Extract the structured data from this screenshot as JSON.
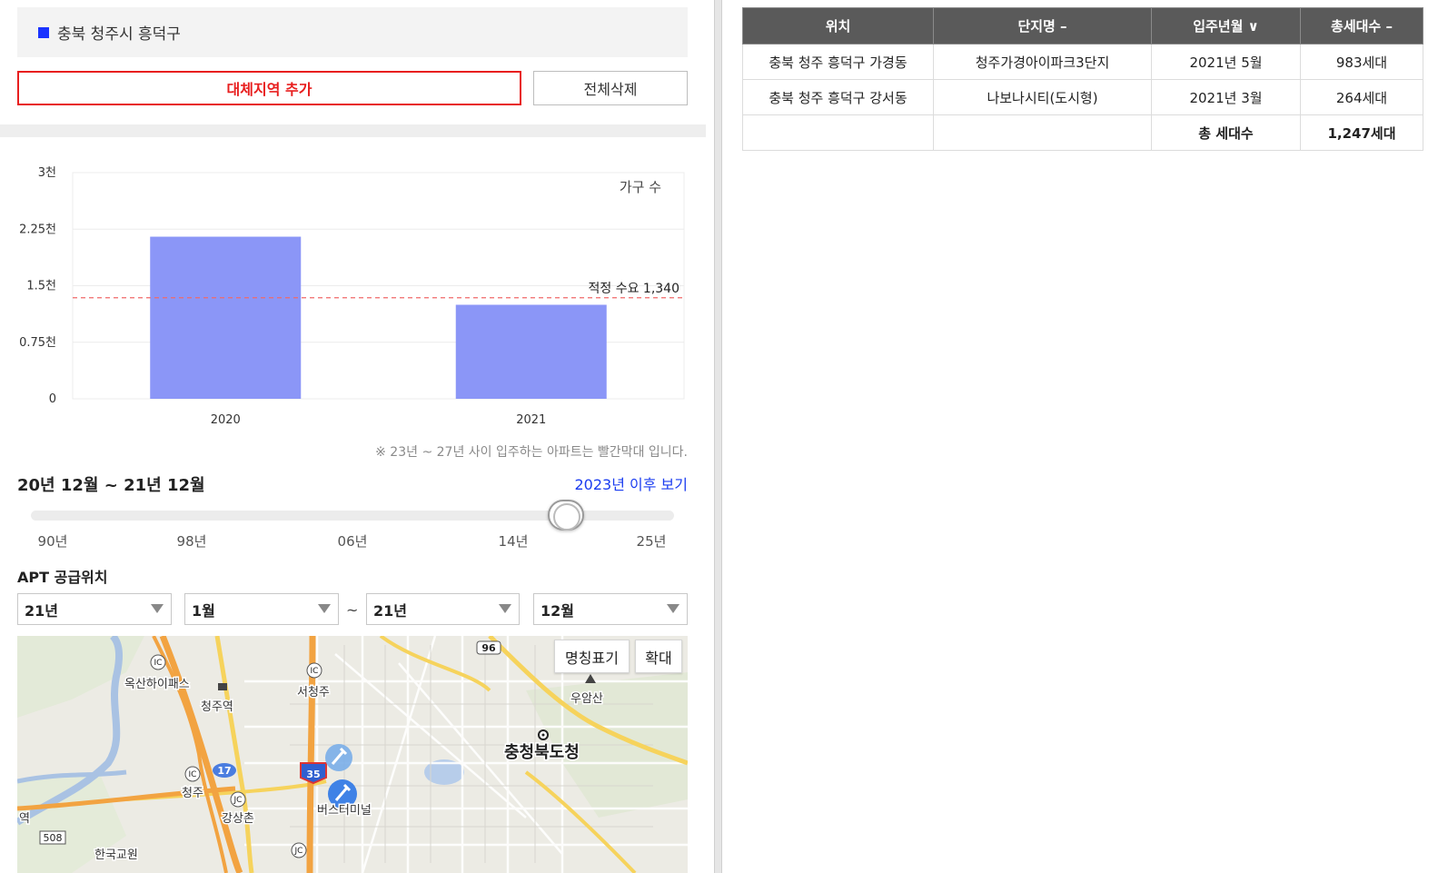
{
  "region": {
    "label": "충북 청주시 흥덕구",
    "marker_color": "#1a33ff"
  },
  "buttons": {
    "add_region": "대체지역 추가",
    "delete_all": "전체삭제"
  },
  "chart_data": {
    "type": "bar",
    "categories": [
      "2020",
      "2021"
    ],
    "values": [
      2150,
      1247
    ],
    "ylim": [
      0,
      3000
    ],
    "yticks": [
      "0",
      "0.75천",
      "1.5천",
      "2.25천",
      "3천"
    ],
    "legend": "가구 수",
    "bar_color": "#8b96f7",
    "reference_line": {
      "value": 1340,
      "label": "적정 수요 1,340",
      "color": "#f06a6a"
    },
    "grid": true
  },
  "chart_note": "※ 23년 ~ 27년 사이 입주하는 아파트는 빨간막대 입니다.",
  "period": {
    "label": "20년 12월 ~ 21년 12월",
    "after_link": "2023년 이후 보기"
  },
  "slider": {
    "ticks": [
      "90년",
      "98년",
      "06년",
      "14년",
      "25년"
    ],
    "value": "21년"
  },
  "apt_section": {
    "title": "APT 공급위치",
    "from_year": "21년",
    "from_month": "1월",
    "to_year": "21년",
    "to_month": "12월",
    "separator": "~"
  },
  "map": {
    "buttons": {
      "names": "명칭표기",
      "zoom": "확대"
    },
    "labels": [
      "옥산하이패스",
      "청주역",
      "서청주",
      "우암산",
      "충청북도청",
      "청주",
      "강상촌",
      "한국교원",
      "버스터미널",
      "역"
    ],
    "shields": [
      "96",
      "35",
      "17",
      "508",
      "IC",
      "JC"
    ]
  },
  "table": {
    "headers": [
      "위치",
      "단지명 –",
      "입주년월 ∨",
      "총세대수 –"
    ],
    "rows": [
      [
        "충북 청주 흥덕구 가경동",
        "청주가경아이파크3단지",
        "2021년 5월",
        "983세대"
      ],
      [
        "충북 청주 흥덕구 강서동",
        "나보나시티(도시형)",
        "2021년 3월",
        "264세대"
      ]
    ],
    "total": {
      "label": "총 세대수",
      "value": "1,247세대"
    }
  }
}
